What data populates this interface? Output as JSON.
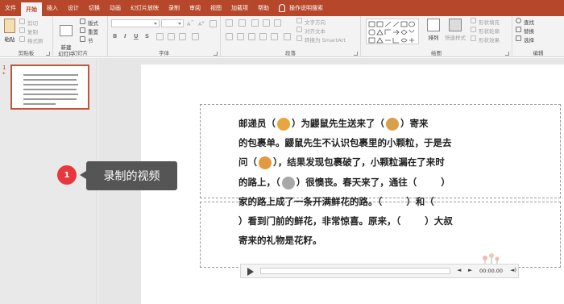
{
  "tabs": [
    "文件",
    "开始",
    "插入",
    "设计",
    "切换",
    "动画",
    "幻灯片放映",
    "录制",
    "审阅",
    "视图",
    "加载项",
    "帮助"
  ],
  "active_tab": "开始",
  "tell_me": "操作说明搜索",
  "ribbon": {
    "clipboard": {
      "paste": "粘贴",
      "cut": "剪切",
      "copy": "复制",
      "format_painter": "格式刷",
      "label": "剪贴板"
    },
    "slides": {
      "new_slide": "新建\n幻灯片",
      "layout": "版式",
      "reset": "重置",
      "section": "节",
      "label": "幻灯片"
    },
    "font": {
      "bold": "B",
      "italic": "I",
      "underline": "U",
      "strike": "S",
      "label": "字体"
    },
    "paragraph": {
      "text_direction": "文字方向",
      "align_text": "对齐文本",
      "smartart": "转换为 SmartArt",
      "label": "段落"
    },
    "drawing": {
      "arrange": "排列",
      "quick_styles": "快速样式",
      "shape_fill": "形状填充",
      "shape_outline": "形状轮廓",
      "shape_effects": "形状效果",
      "label": "绘图"
    },
    "editing": {
      "find": "查找",
      "replace": "替换",
      "select": "选择",
      "label": "编辑"
    }
  },
  "thumbnail": {
    "number": "1",
    "marker": "*"
  },
  "story": {
    "line1a": "邮递员（",
    "line1b": "）为鼹鼠先生送来了（",
    "line1c": "）寄来",
    "line2": "的包裹单。鼹鼠先生不认识包裹里的小颗粒，于是去",
    "line3a": "问（",
    "line3b": "），结果发现包裹破了，小颗粒漏在了来时",
    "line4a": "的路上，（",
    "line4b": "）很懊丧。春天来了，通往（",
    "line4c": "）",
    "line5a": "家的路上成了一条开满鲜花的路。（",
    "line5b": "）和（",
    "line6a": "）看到门前的鲜花，非常惊喜。原来，（",
    "line6b": "）大叔",
    "line7": "寄来的礼物是花籽。"
  },
  "media": {
    "time": "00:00.00",
    "back": "◄",
    "fwd": "►",
    "volume": "◄)"
  },
  "callout": {
    "number": "1",
    "text": "录制的视频"
  },
  "colors": {
    "brand": "#b7472a",
    "callout_dot": "#e8383d",
    "callout_bg": "#555555"
  }
}
